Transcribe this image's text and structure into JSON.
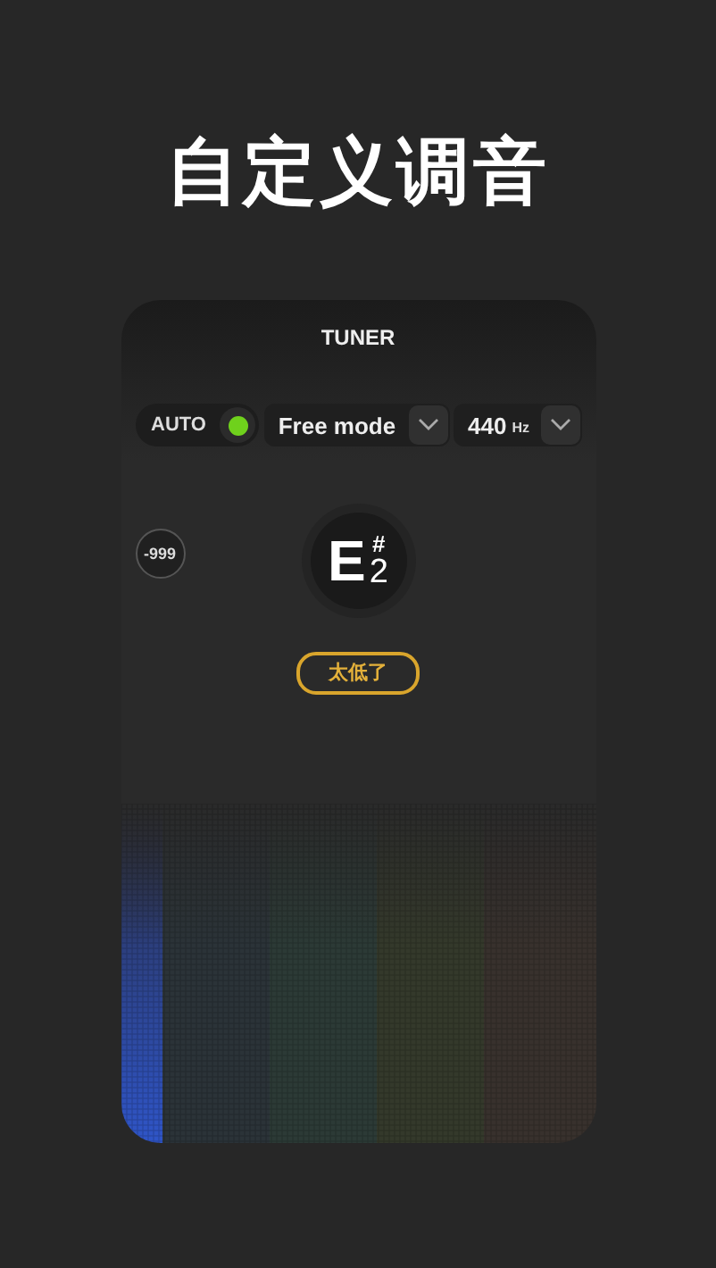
{
  "headline": "自定义调音",
  "tuner": {
    "title": "TUNER",
    "auto": {
      "label": "AUTO",
      "on": true
    },
    "mode": {
      "value": "Free mode"
    },
    "pitch": {
      "value": "440",
      "unit": "Hz"
    },
    "cents": "-999",
    "note": {
      "letter": "E",
      "accidental": "#",
      "octave": "2"
    },
    "status": "太低了"
  }
}
